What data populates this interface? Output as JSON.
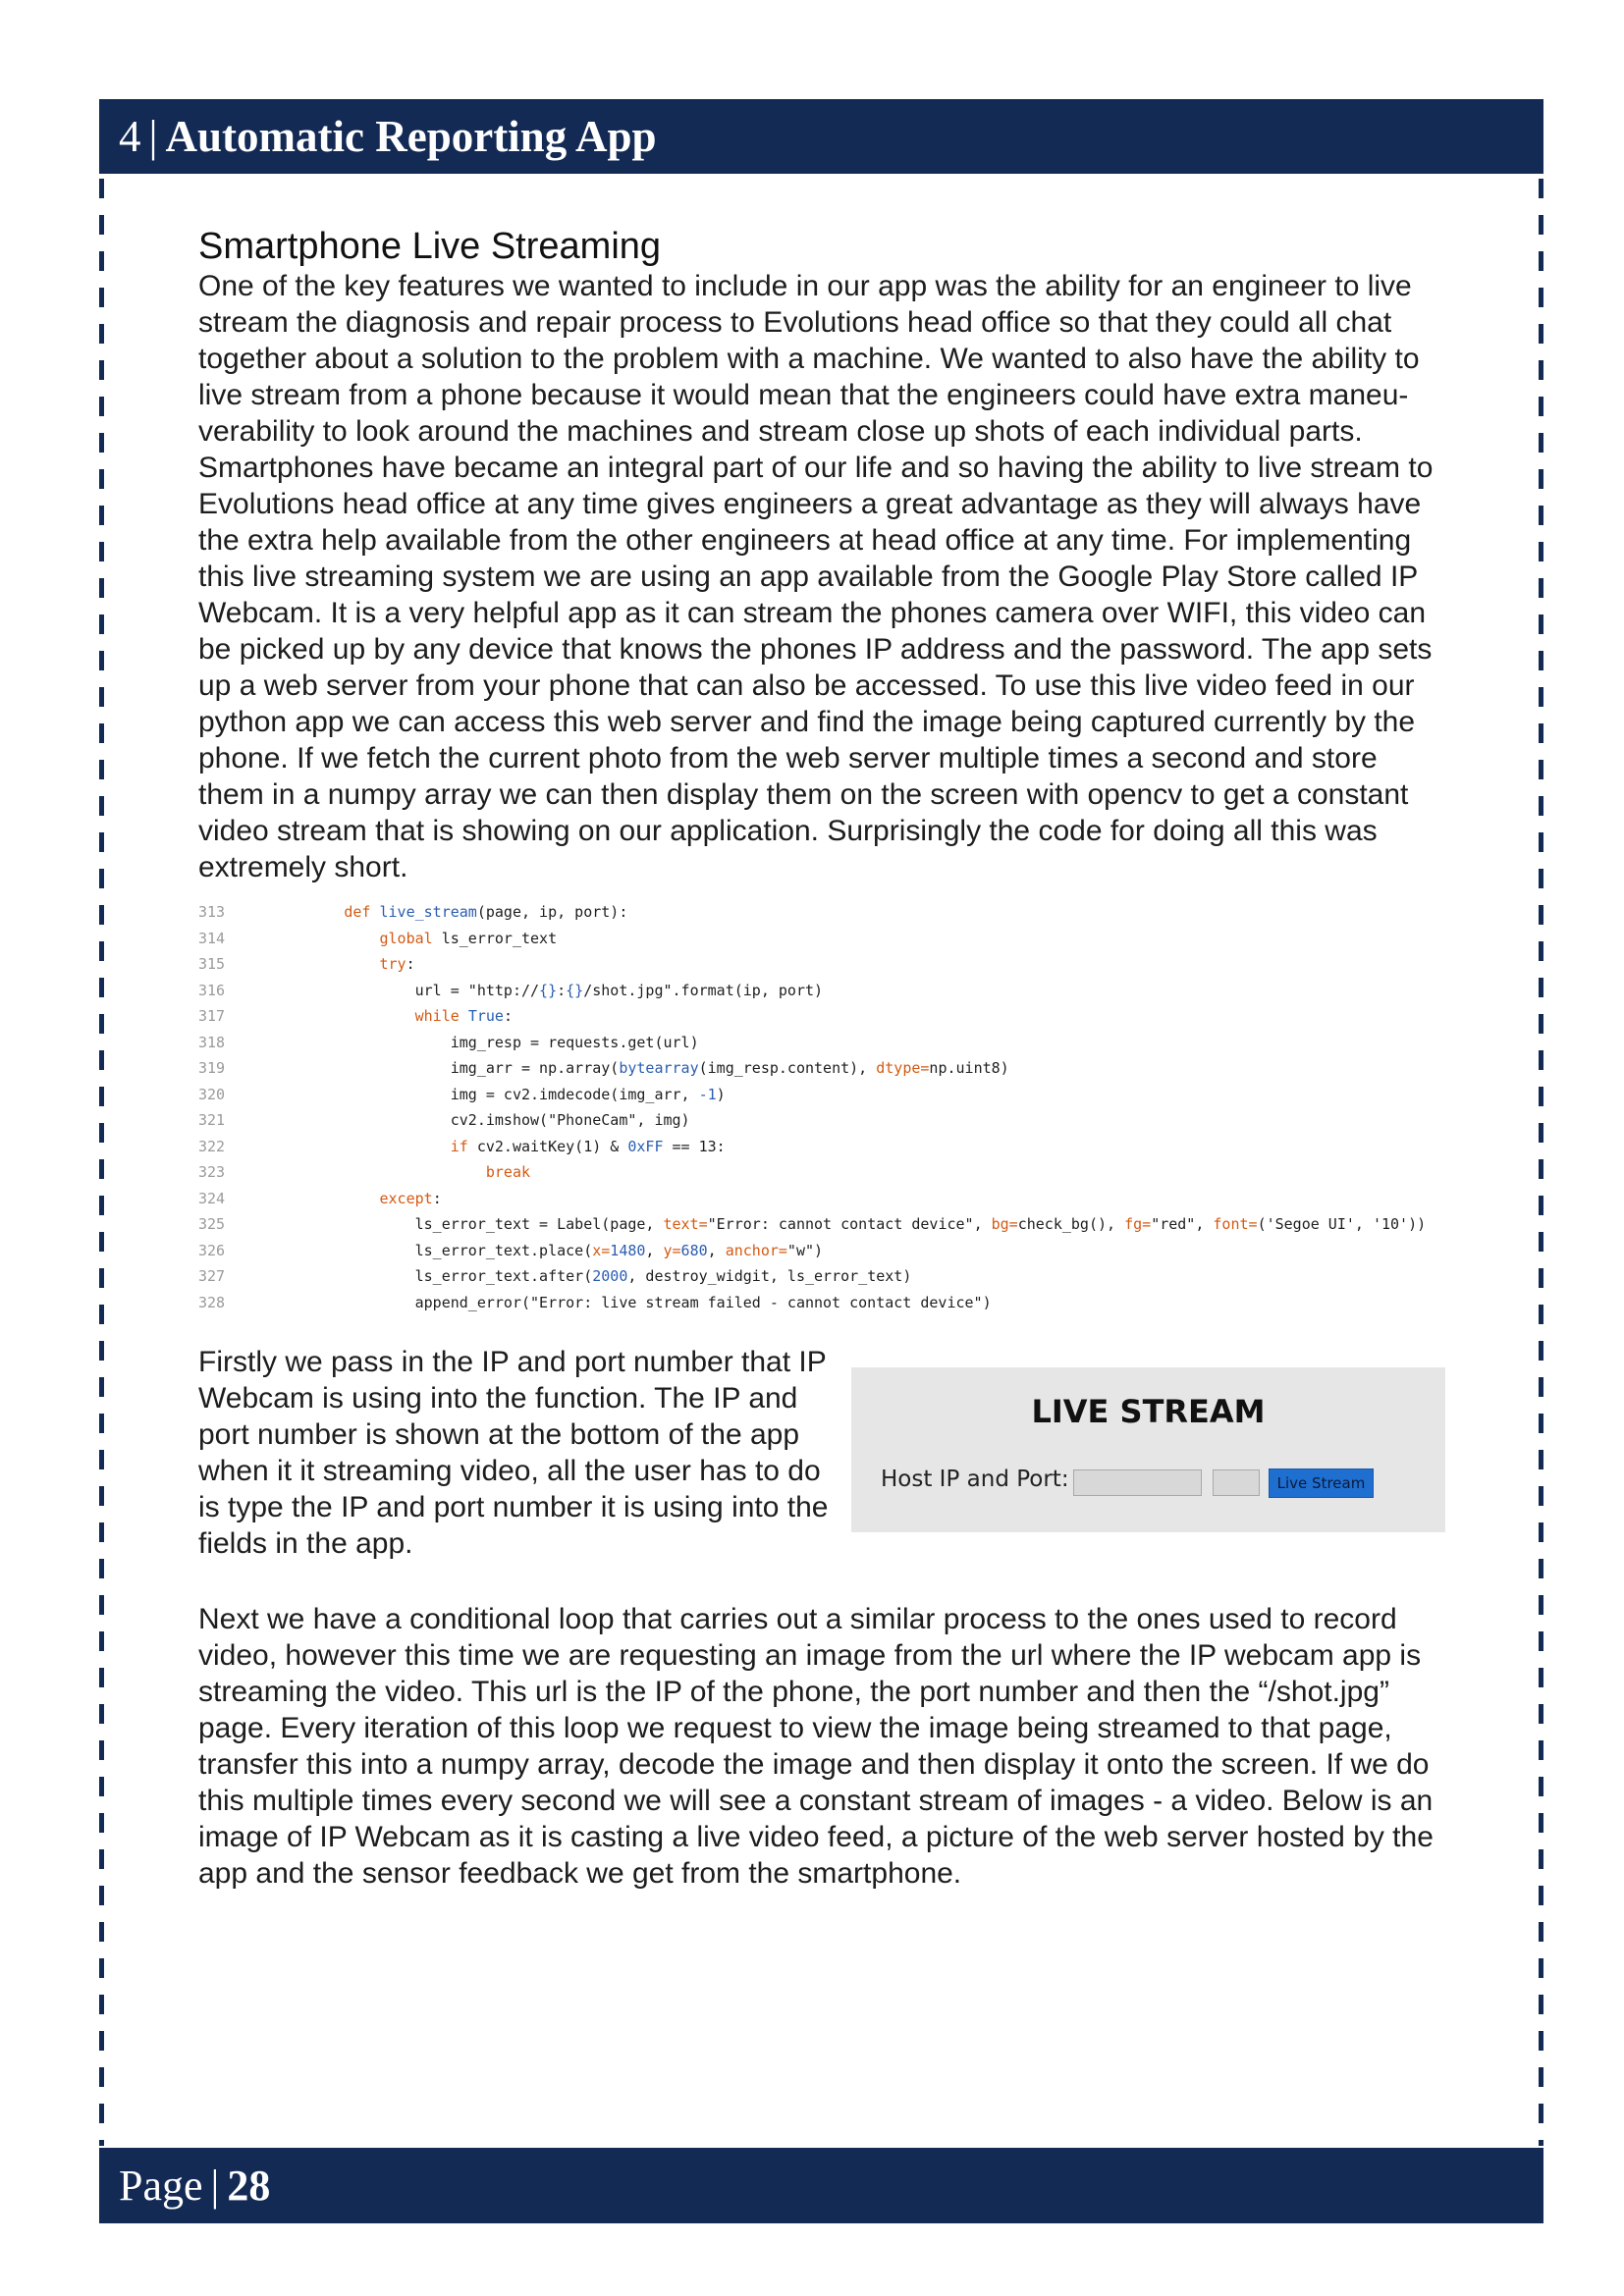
{
  "header": {
    "chapter_number": "4",
    "separator": "|",
    "chapter_title": "Automatic Reporting App"
  },
  "section": {
    "title": "Smartphone Live Streaming",
    "intro_paragraph": "One of the key features we wanted to include in our app was the ability for an engineer to live stream the diagnosis and repair process to Evolutions head office so that they could all chat together about a solution to the problem with a machine. We wanted to also have the ability to live stream from a phone because it would mean that the engineers could have extra maneu-verability to look around the machines and stream close up shots of each individual parts. Smartphones have became an integral part of our life and so having the ability to live stream to Evolutions head office at any time gives engineers a great advantage as they will always have the extra help available from the other engineers at head office at any time. For implementing this live streaming system we are using an app available from the Google Play Store called IP Webcam. It is a very helpful app as it can stream the phones camera over WIFI, this video can be picked up by any device that knows the phones IP address and the password. The app sets up a web server from your phone that can also be accessed. To use this live video feed in our python app we can access this web server and find the image being captured currently by the phone. If we fetch the current photo from the web server multiple times a second and store them in a numpy array we can then display them on the screen with opencv to get a constant video stream that is showing on our application. Surprisingly the code for doing all this was extremely short.",
    "second_paragraph": "Firstly we pass in the IP and port number that IP Webcam is using into the function. The IP and port number is shown at the bottom of the app when it it streaming video, all the user has to do is type the IP and port number it is using into the fields in the app.",
    "third_paragraph": "Next we have a conditional loop that carries out a similar process to the ones used to record video, however this time we are requesting an image from the url where the IP webcam app is streaming the video. This url is the IP of the phone, the port number and then the “/shot.jpg” page.  Every iteration of this loop we request to view the image being streamed to that page, transfer this into a numpy array, decode the image and then display it onto the screen. If we do this multiple times every second we will see a constant stream of images - a video. Below is an image of IP Webcam as it is casting a live video feed, a picture of the web server hosted by the app and the sensor feedback we get from the smartphone."
  },
  "code": {
    "lines": [
      {
        "num": "313",
        "text": "            def live_stream(page, ip, port):"
      },
      {
        "num": "314",
        "text": "                global ls_error_text"
      },
      {
        "num": "315",
        "text": "                try:"
      },
      {
        "num": "316",
        "text": "                    url = \"http://{}:{}/shot.jpg\".format(ip, port)"
      },
      {
        "num": "317",
        "text": "                    while True:"
      },
      {
        "num": "318",
        "text": "                        img_resp = requests.get(url)"
      },
      {
        "num": "319",
        "text": "                        img_arr = np.array(bytearray(img_resp.content), dtype=np.uint8)"
      },
      {
        "num": "320",
        "text": "                        img = cv2.imdecode(img_arr, -1)"
      },
      {
        "num": "321",
        "text": "                        cv2.imshow(\"PhoneCam\", img)"
      },
      {
        "num": "322",
        "text": "                        if cv2.waitKey(1) & 0xFF == 13:"
      },
      {
        "num": "323",
        "text": "                            break"
      },
      {
        "num": "324",
        "text": "                except:"
      },
      {
        "num": "325",
        "text": "                    ls_error_text = Label(page, text=\"Error: cannot contact device\", bg=check_bg(), fg=\"red\", font=('Segoe UI', '10'))"
      },
      {
        "num": "326",
        "text": "                    ls_error_text.place(x=1480, y=680, anchor=\"w\")"
      },
      {
        "num": "327",
        "text": "                    ls_error_text.after(2000, destroy_widgit, ls_error_text)"
      },
      {
        "num": "328",
        "text": "                    append_error(\"Error: live stream failed - cannot contact device\")"
      }
    ]
  },
  "live_stream_panel": {
    "title": "LIVE STREAM",
    "host_label": "Host IP and Port:",
    "button_label": "Live Stream"
  },
  "footer": {
    "page_label": "Page",
    "separator": "|",
    "page_number": "28"
  },
  "colors": {
    "brand_navy": "#132a55",
    "code_keyword": "#d55a13",
    "code_builtin": "#2a5db0",
    "button_blue": "#1f6fd0"
  }
}
